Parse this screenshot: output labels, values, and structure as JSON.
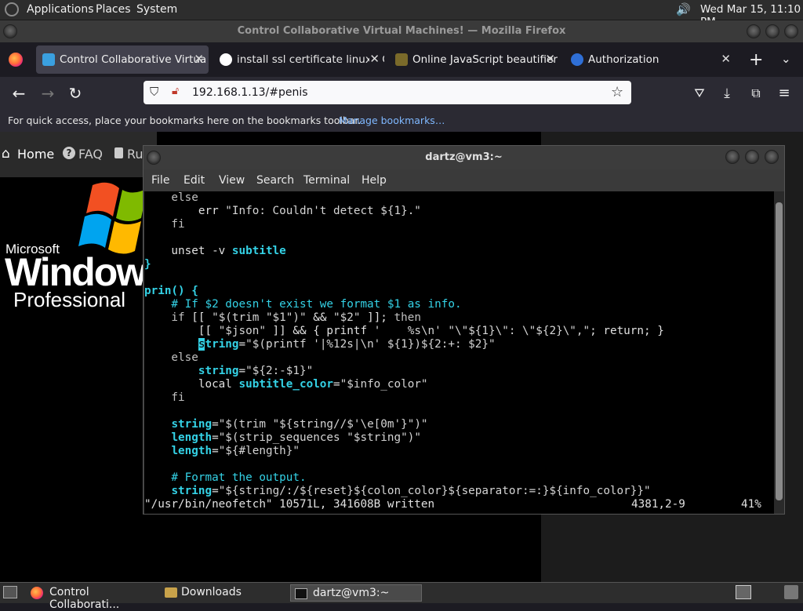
{
  "top_panel": {
    "menus": [
      "Applications",
      "Places",
      "System"
    ],
    "clock": "Wed Mar 15, 11:10 PM"
  },
  "firefox": {
    "window_title": "Control Collaborative Virtual Machines! — Mozilla Firefox",
    "tabs": [
      {
        "label": "Control Collaborative Virtua",
        "icon": "monitor-icon",
        "active": true
      },
      {
        "label": "install ssl certificate linux - G",
        "icon": "google-icon",
        "active": false
      },
      {
        "label": "Online JavaScript beautifier",
        "icon": "js-beautifier-icon",
        "active": false
      },
      {
        "label": "Authorization",
        "icon": "at-sign-icon",
        "active": false
      }
    ],
    "url": "192.168.1.13/#penis",
    "bookmarks_msg": "For quick access, place your bookmarks here on the bookmarks toolbar.",
    "bookmarks_link": "Manage bookmarks…"
  },
  "page": {
    "nav": {
      "home": "Home",
      "faq": "FAQ",
      "ru": "Ru"
    },
    "logo_microsoft": "Microsoft",
    "logo_windows": "Windows",
    "logo_professional": "Professional"
  },
  "terminal": {
    "title": "dartz@vm3:~",
    "menus": [
      "File",
      "Edit",
      "View",
      "Search",
      "Terminal",
      "Help"
    ],
    "status_left": "\"/usr/bin/neofetch\" 10571L, 341608B written",
    "status_pos": "4381,2-9",
    "status_pct": "41%"
  },
  "taskbar": {
    "items": [
      "Control Collaborati...",
      "Downloads",
      "dartz@vm3:~"
    ]
  },
  "colors": {
    "accent": "#34d2e6",
    "link": "#7fb8ff"
  }
}
